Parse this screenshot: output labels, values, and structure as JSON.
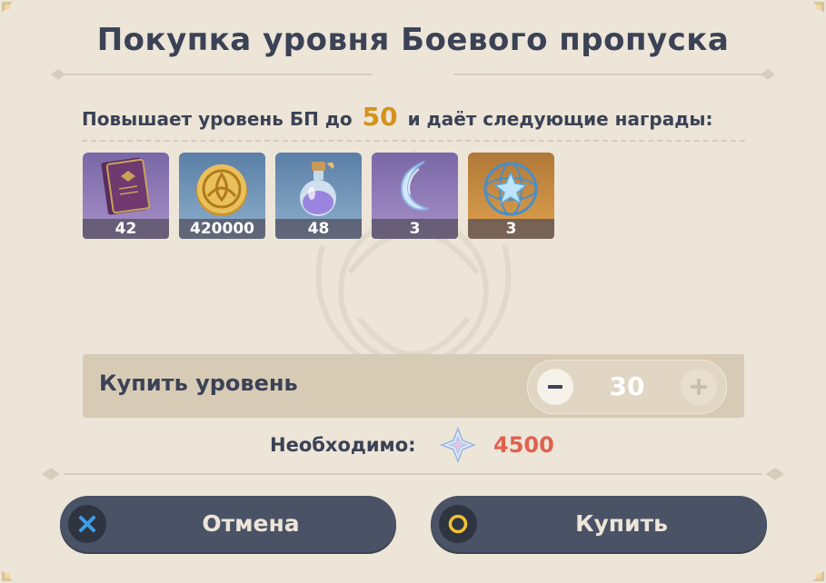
{
  "dialog": {
    "title": "Покупка уровня Боевого пропуска",
    "description": {
      "prefix": "Повышает уровень БП до",
      "level": "50",
      "suffix": "и даёт следующие награды:"
    }
  },
  "rewards": [
    {
      "name": "book-icon",
      "count": "42",
      "rarity": "purple"
    },
    {
      "name": "mora-coin-icon",
      "count": "420000",
      "rarity": "blue"
    },
    {
      "name": "potion-bottle-icon",
      "count": "48",
      "rarity": "blue"
    },
    {
      "name": "crescent-moon-icon",
      "count": "3",
      "rarity": "purple"
    },
    {
      "name": "crystal-sphere-icon",
      "count": "3",
      "rarity": "gold"
    }
  ],
  "purchase": {
    "label": "Купить уровень",
    "quantity": "30"
  },
  "cost": {
    "label": "Необходимо:",
    "amount": "4500",
    "currency_icon": "primogem-icon"
  },
  "buttons": {
    "cancel": "Отмена",
    "confirm": "Купить"
  },
  "colors": {
    "background": "#ece5d8",
    "text": "#3b4255",
    "level_accent": "#d4921c",
    "cost_accent": "#e0624e",
    "button_bg": "#4a5266"
  }
}
